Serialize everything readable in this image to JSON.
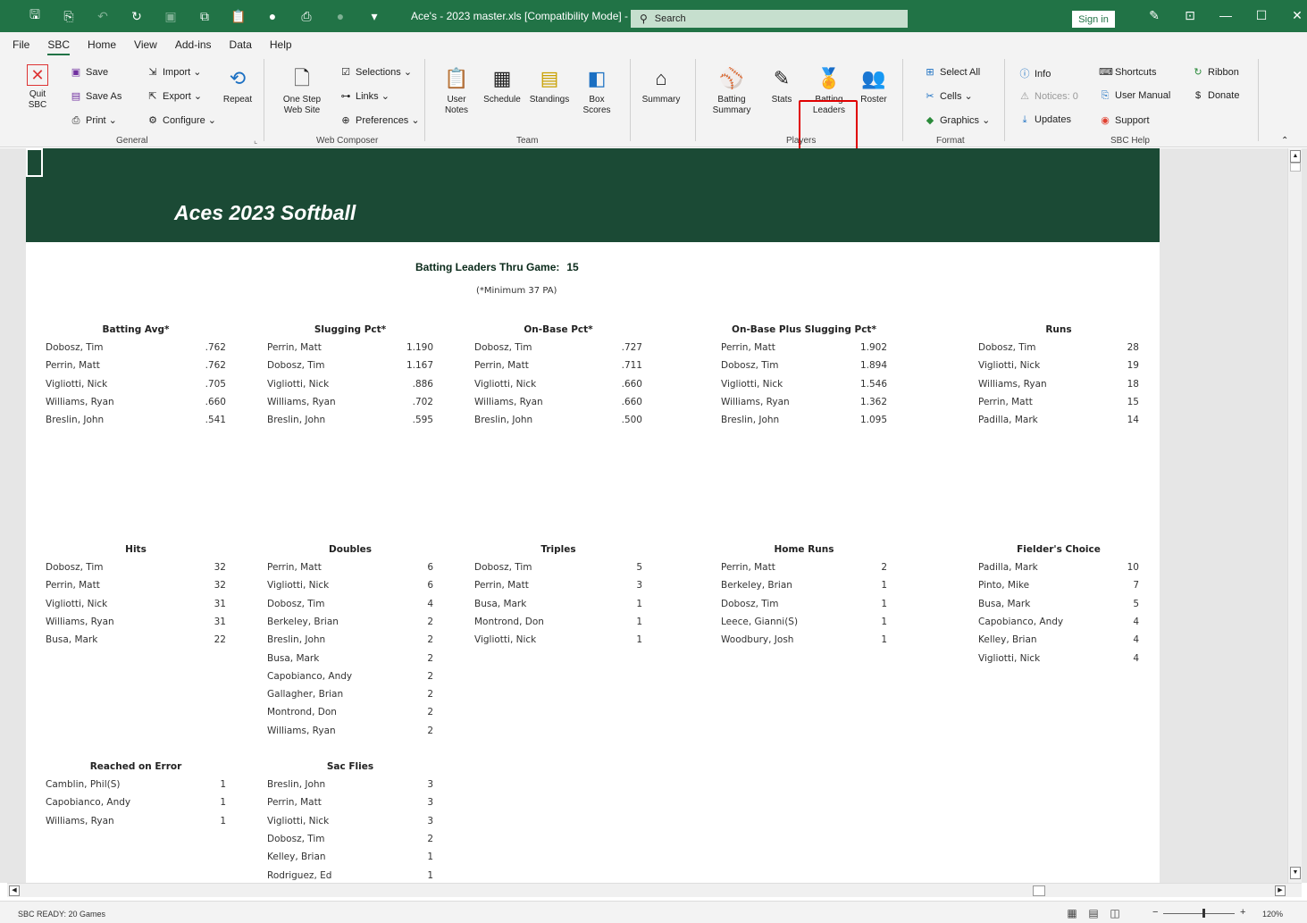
{
  "titlebar": {
    "doc_title": "Ace's - 2023 master.xls  [Compatibility Mode]  -  E...",
    "search_label": "Search",
    "sign_in": "Sign in"
  },
  "menu": {
    "tabs": [
      "File",
      "SBC",
      "Home",
      "View",
      "Add-ins",
      "Data",
      "Help"
    ],
    "active": "SBC"
  },
  "ribbon": {
    "general": {
      "quit": "Quit SBC",
      "save": "Save",
      "save_as": "Save As",
      "print": "Print",
      "import": "Import",
      "export": "Export",
      "configure": "Configure",
      "repeat": "Repeat",
      "label": "General"
    },
    "web_composer": {
      "one_step": "One Step Web Site",
      "selections": "Selections",
      "links": "Links",
      "preferences": "Preferences",
      "label": "Web Composer"
    },
    "team": {
      "user_notes": "User Notes",
      "schedule": "Schedule",
      "standings": "Standings",
      "box_scores": "Box Scores",
      "summary": "Summary",
      "label": "Team"
    },
    "players": {
      "batting_summary": "Batting Summary",
      "stats": "Stats",
      "batting_leaders": "Batting Leaders",
      "roster": "Roster",
      "label": "Players"
    },
    "format": {
      "select_all": "Select All",
      "cells": "Cells",
      "graphics": "Graphics",
      "label": "Format"
    },
    "sbc_help": {
      "info": "Info",
      "notices": "Notices: 0",
      "updates": "Updates",
      "shortcuts": "Shortcuts",
      "user_manual": "User Manual",
      "support": "Support",
      "ribbon": "Ribbon",
      "donate": "Donate",
      "label": "SBC Help"
    }
  },
  "sheet": {
    "banner_title": "Aces 2023 Softball",
    "heading": "Batting Leaders Thru Game:",
    "game_number": "15",
    "subheading": "(*Minimum 37 PA)"
  },
  "categories": [
    {
      "title": "Batting Avg*",
      "rows": [
        [
          "Dobosz, Tim",
          ".762"
        ],
        [
          "Perrin, Matt",
          ".762"
        ],
        [
          "Vigliotti, Nick",
          ".705"
        ],
        [
          "Williams, Ryan",
          ".660"
        ],
        [
          "Breslin, John",
          ".541"
        ]
      ]
    },
    {
      "title": "Slugging Pct*",
      "rows": [
        [
          "Perrin, Matt",
          "1.190"
        ],
        [
          "Dobosz, Tim",
          "1.167"
        ],
        [
          "Vigliotti, Nick",
          ".886"
        ],
        [
          "Williams, Ryan",
          ".702"
        ],
        [
          "Breslin, John",
          ".595"
        ]
      ]
    },
    {
      "title": "On-Base Pct*",
      "rows": [
        [
          "Dobosz, Tim",
          ".727"
        ],
        [
          "Perrin, Matt",
          ".711"
        ],
        [
          "Vigliotti, Nick",
          ".660"
        ],
        [
          "Williams, Ryan",
          ".660"
        ],
        [
          "Breslin, John",
          ".500"
        ]
      ]
    },
    {
      "title": "On-Base Plus Slugging Pct*",
      "rows": [
        [
          "Perrin, Matt",
          "1.902"
        ],
        [
          "Dobosz, Tim",
          "1.894"
        ],
        [
          "Vigliotti, Nick",
          "1.546"
        ],
        [
          "Williams, Ryan",
          "1.362"
        ],
        [
          "Breslin, John",
          "1.095"
        ]
      ]
    },
    {
      "title": "Runs",
      "rows": [
        [
          "Dobosz, Tim",
          "28"
        ],
        [
          "Vigliotti, Nick",
          "19"
        ],
        [
          "Williams, Ryan",
          "18"
        ],
        [
          "Perrin, Matt",
          "15"
        ],
        [
          "Padilla, Mark",
          "14"
        ]
      ]
    },
    {
      "title": "Hits",
      "rows": [
        [
          "Dobosz, Tim",
          "32"
        ],
        [
          "Perrin, Matt",
          "32"
        ],
        [
          "Vigliotti, Nick",
          "31"
        ],
        [
          "Williams, Ryan",
          "31"
        ],
        [
          "Busa, Mark",
          "22"
        ]
      ]
    },
    {
      "title": "Doubles",
      "rows": [
        [
          "Perrin, Matt",
          "6"
        ],
        [
          "Vigliotti, Nick",
          "6"
        ],
        [
          "Dobosz, Tim",
          "4"
        ],
        [
          "Berkeley, Brian",
          "2"
        ],
        [
          "Breslin, John",
          "2"
        ],
        [
          "Busa, Mark",
          "2"
        ],
        [
          "Capobianco, Andy",
          "2"
        ],
        [
          "Gallagher, Brian",
          "2"
        ],
        [
          "Montrond, Don",
          "2"
        ],
        [
          "Williams, Ryan",
          "2"
        ]
      ]
    },
    {
      "title": "Triples",
      "rows": [
        [
          "Dobosz, Tim",
          "5"
        ],
        [
          "Perrin, Matt",
          "3"
        ],
        [
          "Busa, Mark",
          "1"
        ],
        [
          "Montrond, Don",
          "1"
        ],
        [
          "Vigliotti, Nick",
          "1"
        ]
      ]
    },
    {
      "title": "Home Runs",
      "rows": [
        [
          "Perrin, Matt",
          "2"
        ],
        [
          "Berkeley, Brian",
          "1"
        ],
        [
          "Dobosz, Tim",
          "1"
        ],
        [
          "Leece, Gianni(S)",
          "1"
        ],
        [
          "Woodbury, Josh",
          "1"
        ]
      ]
    },
    {
      "title": "Fielder's Choice",
      "rows": [
        [
          "Padilla, Mark",
          "10"
        ],
        [
          "Pinto, Mike",
          "7"
        ],
        [
          "Busa, Mark",
          "5"
        ],
        [
          "Capobianco, Andy",
          "4"
        ],
        [
          "Kelley, Brian",
          "4"
        ],
        [
          "Vigliotti, Nick",
          "4"
        ]
      ]
    },
    {
      "title": "Reached on Error",
      "rows": [
        [
          "Camblin, Phil(S)",
          "1"
        ],
        [
          "Capobianco, Andy",
          "1"
        ],
        [
          "Williams, Ryan",
          "1"
        ]
      ]
    },
    {
      "title": "Sac Flies",
      "rows": [
        [
          "Breslin, John",
          "3"
        ],
        [
          "Perrin, Matt",
          "3"
        ],
        [
          "Vigliotti, Nick",
          "3"
        ],
        [
          "Dobosz, Tim",
          "2"
        ],
        [
          "Kelley, Brian",
          "1"
        ],
        [
          "Rodriguez, Ed",
          "1"
        ]
      ]
    }
  ],
  "status": {
    "text": "SBC READY: 20 Games",
    "zoom": "120%"
  },
  "colors": {
    "excel_green": "#217346",
    "banner_green": "#1b4a35",
    "highlight_red": "#e00000"
  }
}
